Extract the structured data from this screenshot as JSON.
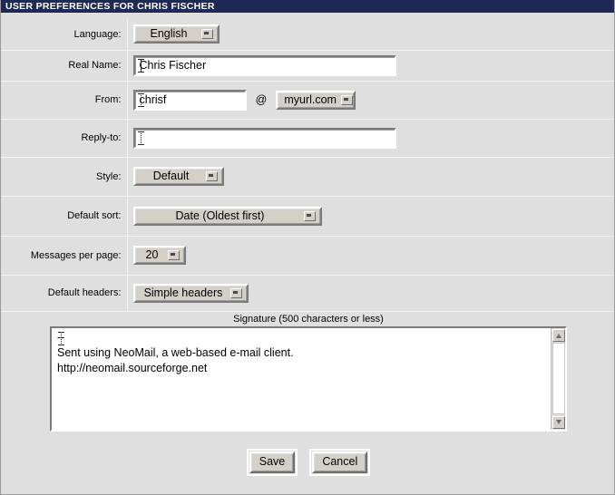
{
  "window": {
    "title": "USER PREFERENCES FOR CHRIS FISCHER",
    "titlebar_color": "#1e2a55",
    "background_color": "#dfdfdf"
  },
  "form": {
    "rows": [
      {
        "label": "Language:",
        "type": "select",
        "value": "English"
      },
      {
        "label": "Real Name:",
        "type": "text",
        "value": "Chris Fischer"
      },
      {
        "label": "From:",
        "type": "text",
        "value": "chrisf"
      },
      {
        "label": "Reply-to:",
        "type": "text",
        "value": ""
      },
      {
        "label": "Style:",
        "type": "select",
        "value": "Default"
      },
      {
        "label": "Default sort:",
        "type": "select",
        "value": "Date (Oldest first)"
      },
      {
        "label": "Messages per page:",
        "type": "select",
        "value": "20"
      },
      {
        "label": "Default headers:",
        "type": "select",
        "value": "Simple headers"
      }
    ],
    "from_at_symbol": "@",
    "from_domain": "myurl.com"
  },
  "signature": {
    "label": "Signature (500 characters or less)",
    "value": "--\nSent using NeoMail, a web-based e-mail client.\nhttp://neomail.sourceforge.net"
  },
  "actions": {
    "save_label": "Save",
    "cancel_label": "Cancel"
  }
}
